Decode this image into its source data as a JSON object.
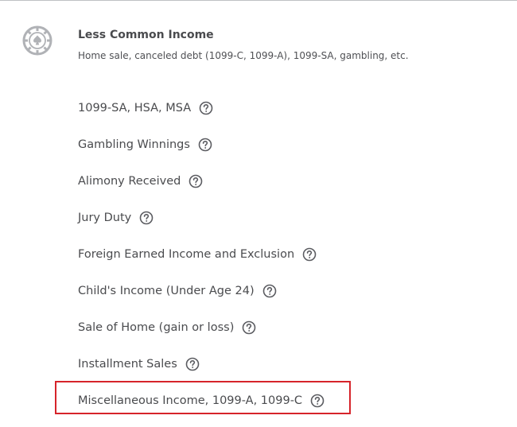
{
  "section": {
    "icon": "poker-chip-icon",
    "title": "Less Common Income",
    "subtitle": "Home sale, canceled debt (1099-C, 1099-A), 1099-SA, gambling, etc."
  },
  "items": [
    {
      "label": "1099-SA, HSA, MSA",
      "icon": "help-icon"
    },
    {
      "label": "Gambling Winnings",
      "icon": "help-icon"
    },
    {
      "label": "Alimony Received",
      "icon": "help-icon"
    },
    {
      "label": "Jury Duty",
      "icon": "help-icon"
    },
    {
      "label": "Foreign Earned Income and Exclusion",
      "icon": "help-icon"
    },
    {
      "label": "Child's Income (Under Age 24)",
      "icon": "help-icon"
    },
    {
      "label": "Sale of Home (gain or loss)",
      "icon": "help-icon"
    },
    {
      "label": "Installment Sales",
      "icon": "help-icon"
    },
    {
      "label": "Miscellaneous Income, 1099-A, 1099-C",
      "icon": "help-icon"
    }
  ],
  "colors": {
    "text": "#4a4b4e",
    "icon": "#6b6c72",
    "highlight_border": "#d6242a",
    "divider": "#bfc1c4"
  }
}
